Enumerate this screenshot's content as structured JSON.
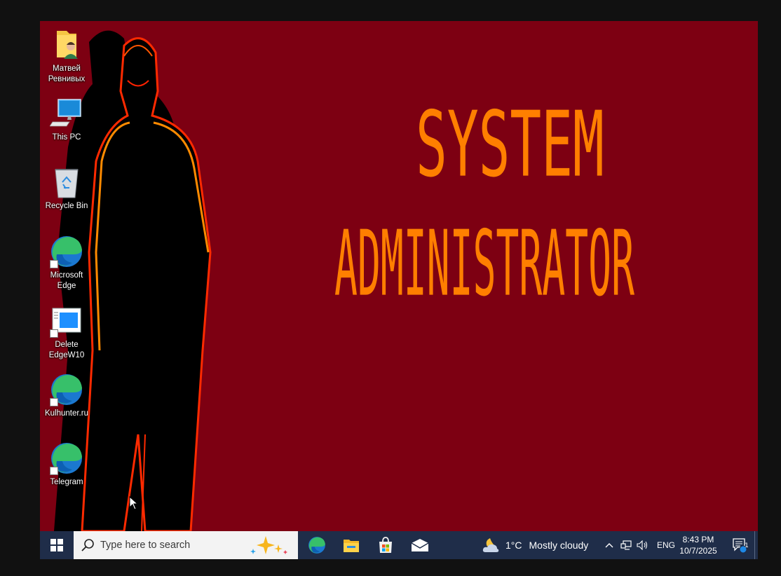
{
  "wallpaper": {
    "line1": "SYSTEM",
    "line2": "ADMINISTRATOR",
    "background_color": "#7d0012",
    "text_color": "#ff7f00"
  },
  "desktop_icons": [
    {
      "label": "Матвей Ревнивых",
      "icon": "user-folder-icon"
    },
    {
      "label": "This PC",
      "icon": "computer-icon"
    },
    {
      "label": "Recycle Bin",
      "icon": "recycle-bin-icon"
    },
    {
      "label": "Microsoft Edge",
      "icon": "edge-icon"
    },
    {
      "label": "Delete EdgeW10",
      "icon": "window-app-icon"
    },
    {
      "label": "Kulhunter.ru",
      "icon": "edge-icon"
    },
    {
      "label": "Telegram",
      "icon": "edge-icon"
    }
  ],
  "taskbar": {
    "search_placeholder": "Type here to search",
    "pinned_apps": [
      "edge-icon",
      "file-explorer-icon",
      "store-icon",
      "mail-icon"
    ],
    "weather": {
      "temp": "1°C",
      "condition": "Mostly cloudy",
      "icon": "partly-cloudy-night-icon"
    },
    "language": "ENG",
    "time": "8:43 PM",
    "date": "10/7/2025",
    "notification_count": "1",
    "color": "#1f2d49"
  }
}
